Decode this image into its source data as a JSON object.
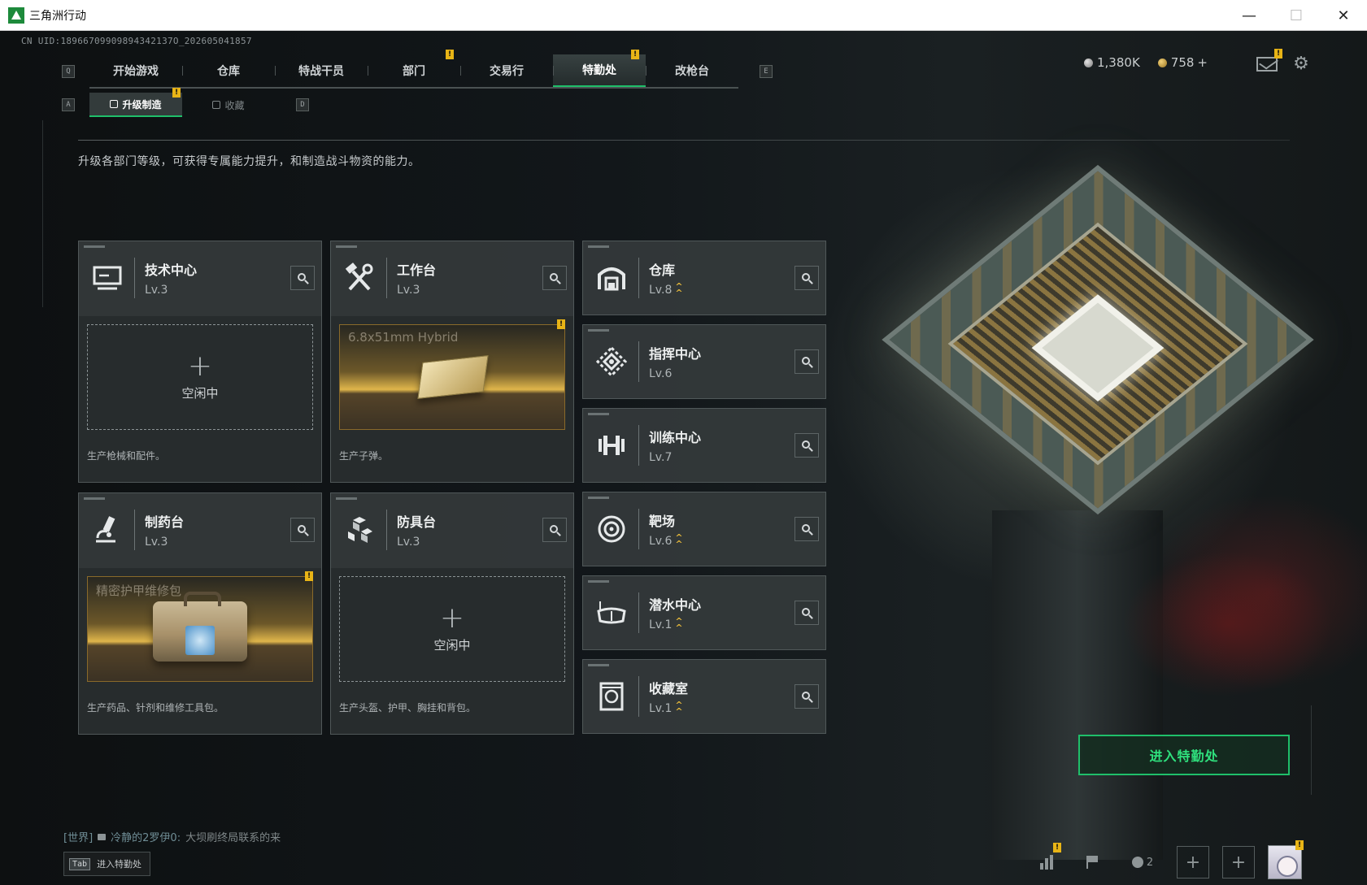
{
  "window": {
    "title": "三角洲行动",
    "minimize": "—",
    "maximize": "☐",
    "close": "✕"
  },
  "cn_uid": "CN UID:18966709909894342137O_202605041857",
  "keyhints": {
    "q": "Q",
    "e": "E",
    "a": "A",
    "d": "D"
  },
  "nav": {
    "tabs": [
      {
        "label": "开始游戏",
        "alert": false
      },
      {
        "label": "仓库",
        "alert": false
      },
      {
        "label": "特战干员",
        "alert": false
      },
      {
        "label": "部门",
        "alert": true
      },
      {
        "label": "交易行",
        "alert": false
      },
      {
        "label": "特勤处",
        "alert": true,
        "active": true
      },
      {
        "label": "改枪台",
        "alert": false
      }
    ]
  },
  "alert_mark": "!",
  "currency": {
    "silver": "1,380K",
    "gold": "758",
    "plus": "+"
  },
  "subnav": {
    "tabs": [
      {
        "label": "升级制造",
        "active": true,
        "alert": true
      },
      {
        "label": "收藏",
        "active": false,
        "alert": false
      }
    ]
  },
  "description": "升级各部门等级，可获得专属能力提升，和制造战斗物资的能力。",
  "idle_plus": "+",
  "production_cards": [
    {
      "name": "技术中心",
      "level": "Lv.3",
      "icon": "monitor-icon",
      "slot": {
        "state": "idle",
        "label": "空闲中"
      },
      "desc": "生产枪械和配件。"
    },
    {
      "name": "工作台",
      "level": "Lv.3",
      "icon": "tools-icon",
      "slot": {
        "state": "item",
        "item_name": "6.8x51mm Hybrid",
        "alert": true
      },
      "desc": "生产子弹。"
    },
    {
      "name": "制药台",
      "level": "Lv.3",
      "icon": "microscope-icon",
      "slot": {
        "state": "item",
        "item_name": "精密护甲维修包",
        "alert": true
      },
      "desc": "生产药品、针剂和维修工具包。"
    },
    {
      "name": "防具台",
      "level": "Lv.3",
      "icon": "blocks-icon",
      "slot": {
        "state": "idle",
        "label": "空闲中"
      },
      "desc": "生产头盔、护甲、胸挂和背包。"
    }
  ],
  "facility_cards": [
    {
      "name": "仓库",
      "level": "Lv.8",
      "upgradable": true,
      "icon": "warehouse-icon"
    },
    {
      "name": "指挥中心",
      "level": "Lv.6",
      "upgradable": false,
      "icon": "command-icon"
    },
    {
      "name": "训练中心",
      "level": "Lv.7",
      "upgradable": false,
      "icon": "dumbbell-icon"
    },
    {
      "name": "靶场",
      "level": "Lv.6",
      "upgradable": true,
      "icon": "target-icon"
    },
    {
      "name": "潜水中心",
      "level": "Lv.1",
      "upgradable": true,
      "icon": "goggles-icon"
    },
    {
      "name": "收藏室",
      "level": "Lv.1",
      "upgradable": true,
      "icon": "vault-icon"
    }
  ],
  "enter_button": "进入特勤处",
  "chat": {
    "channel": "[世界]",
    "user": "冷静的2罗伊0:",
    "message": "大坝刷终局联系的来"
  },
  "tab_hint": {
    "key": "Tab",
    "label": "进入特勤处"
  },
  "bottom_bar": {
    "squad_count": "2",
    "plus": "+"
  },
  "colors": {
    "accent_green": "#1fbf6a",
    "alert_yellow": "#e8b416",
    "upgrade_gold": "#e3b63a"
  }
}
